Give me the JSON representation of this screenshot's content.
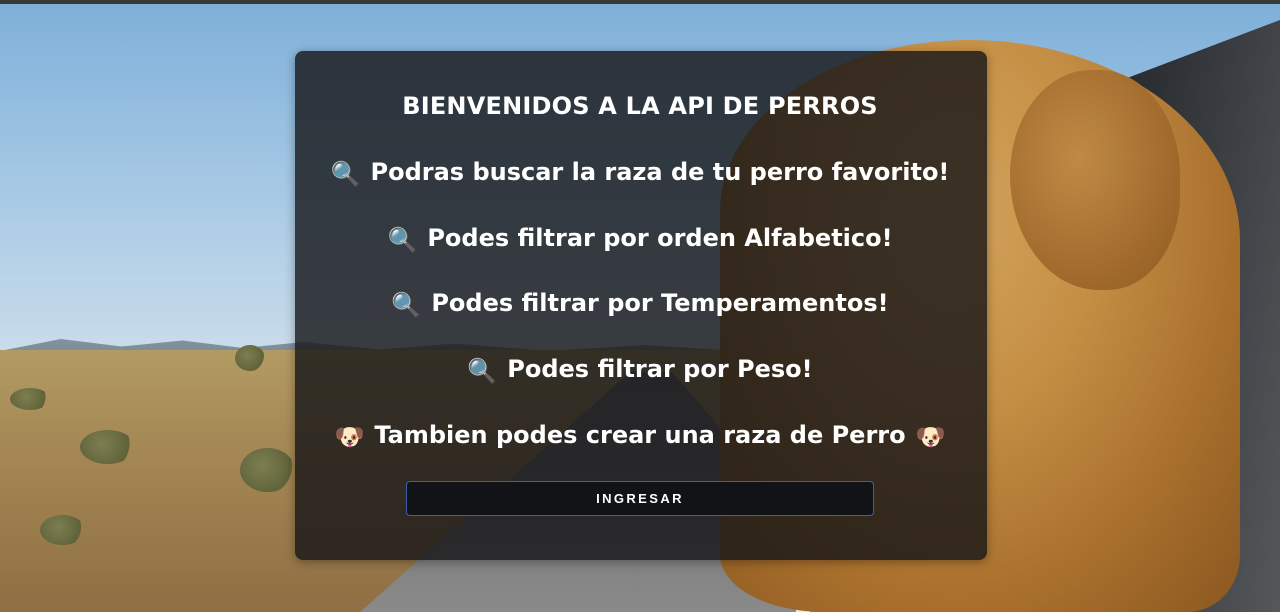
{
  "welcome": {
    "title": "BIENVENIDOS A LA API DE PERROS",
    "features": [
      {
        "icon": "magnifying-glass-icon",
        "text": "Podras buscar la raza de tu perro favorito!"
      },
      {
        "icon": "magnifying-glass-icon",
        "text": "Podes filtrar por orden Alfabetico!"
      },
      {
        "icon": "magnifying-glass-icon",
        "text": "Podes filtrar por Temperamentos!"
      },
      {
        "icon": "magnifying-glass-icon",
        "text": "Podes filtrar por Peso!"
      },
      {
        "icon": "dog-face-icon",
        "text": "Tambien podes crear una raza de Perro"
      }
    ],
    "enter_button": "INGRESAR"
  },
  "colors": {
    "card_background": "#141416",
    "button_border": "#3e5fa8",
    "text": "#ffffff"
  }
}
